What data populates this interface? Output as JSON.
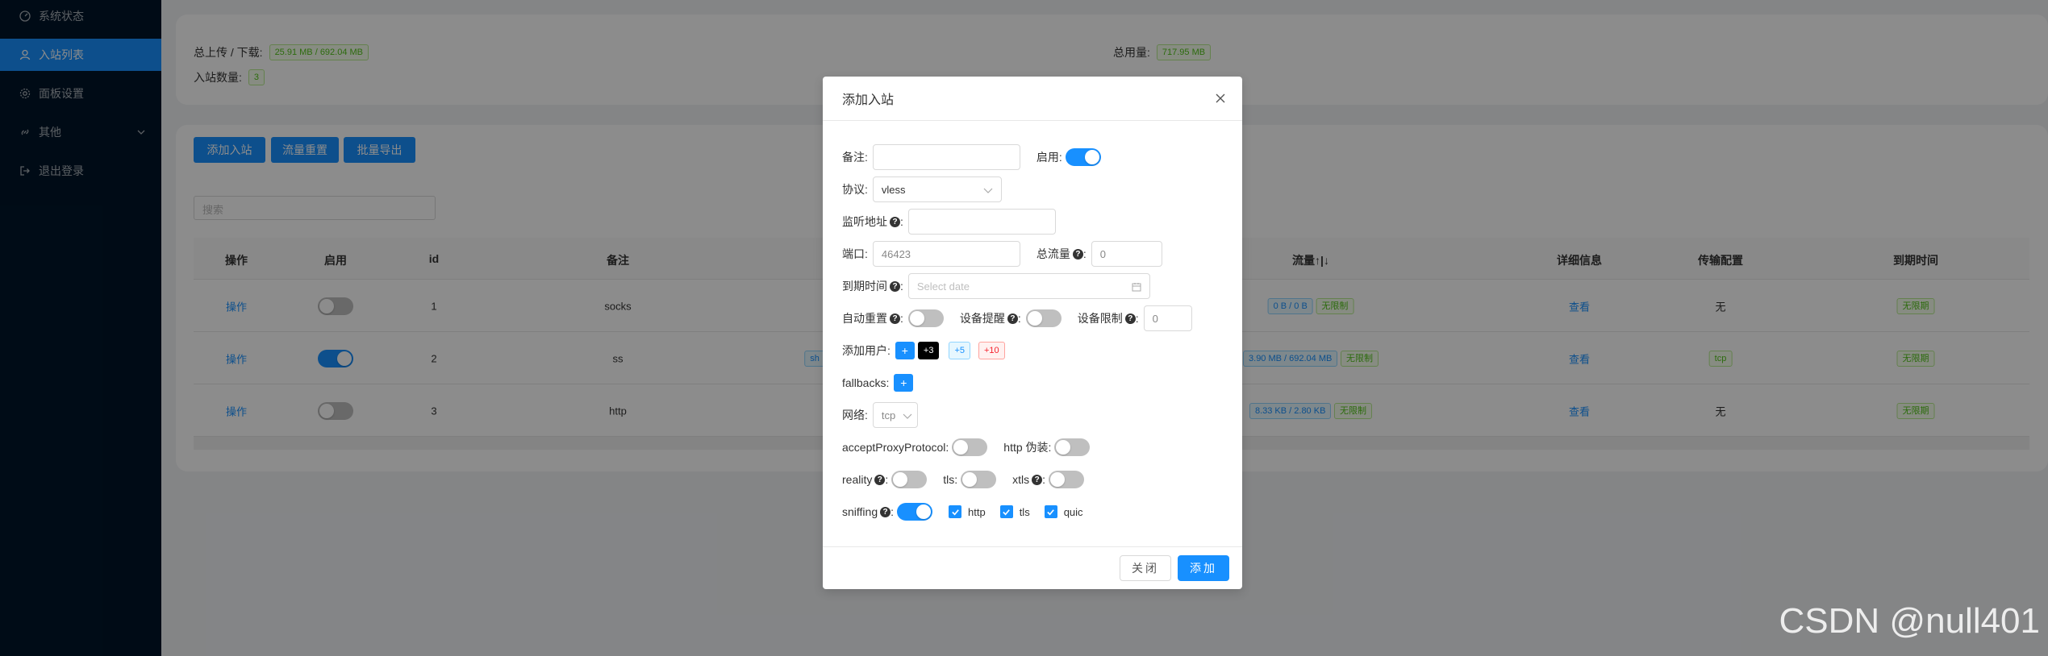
{
  "sidebar": {
    "items": [
      {
        "label": "系统状态",
        "icon": "dashboard-icon"
      },
      {
        "label": "入站列表",
        "icon": "user-icon",
        "active": true
      },
      {
        "label": "面板设置",
        "icon": "gear-icon"
      },
      {
        "label": "其他",
        "icon": "link-icon"
      },
      {
        "label": "退出登录",
        "icon": "logout-icon"
      }
    ]
  },
  "stats": {
    "upload_download_label": "总上传 / 下载:",
    "upload_download_value": "25.91 MB / 692.04 MB",
    "total_usage_label": "总用量:",
    "total_usage_value": "717.95 MB",
    "inbound_count_label": "入站数量:",
    "inbound_count_value": "3"
  },
  "toolbar": {
    "add_inbound": "添加入站",
    "reset_traffic": "流量重置",
    "batch_export": "批量导出",
    "search_placeholder": "搜索"
  },
  "table": {
    "headers": [
      "操作",
      "启用",
      "id",
      "备注",
      "流量↑|↓",
      "详细信息",
      "传输配置",
      "到期时间"
    ],
    "rows": [
      {
        "op": "操作",
        "enabled": false,
        "id": "1",
        "remark": "socks",
        "traffic": "0 B / 0 B",
        "limit": "无限制",
        "detail": "查看",
        "transport": "无",
        "expiry": "无限期"
      },
      {
        "op": "操作",
        "enabled": true,
        "id": "2",
        "remark": "ss",
        "protocol_tag": "sh",
        "traffic": "3.90 MB / 692.04 MB",
        "limit": "无限制",
        "detail": "查看",
        "transport": "tcp",
        "expiry": "无限期"
      },
      {
        "op": "操作",
        "enabled": false,
        "id": "3",
        "remark": "http",
        "traffic": "8.33 KB / 2.80 KB",
        "limit": "无限制",
        "detail": "查看",
        "transport": "无",
        "expiry": "无限期"
      }
    ]
  },
  "modal": {
    "title": "添加入站",
    "remark_label": "备注:",
    "remark_value": "",
    "enable_label": "启用:",
    "enable_on": true,
    "protocol_label": "协议:",
    "protocol_value": "vless",
    "listen_label": "监听地址",
    "listen_value": "",
    "port_label": "端口:",
    "port_value": "46423",
    "total_traffic_label": "总流量",
    "total_traffic_value": "0",
    "expiry_label": "到期时间",
    "expiry_placeholder": "Select date",
    "auto_reset_label": "自动重置",
    "device_alert_label": "设备提醒",
    "device_limit_label": "设备限制",
    "device_limit_value": "0",
    "add_user_label": "添加用户:",
    "add_user_plus": "+",
    "add_user_3": "+3",
    "add_user_5": "+5",
    "add_user_10": "+10",
    "fallbacks_label": "fallbacks:",
    "fallbacks_plus": "+",
    "network_label": "网络:",
    "network_value": "tcp",
    "accept_proxy_label": "acceptProxyProtocol:",
    "http_camouflage_label": "http 伪装:",
    "reality_label": "reality",
    "tls_label": "tls:",
    "xtls_label": "xtls",
    "sniffing_label": "sniffing",
    "sniff_http": "http",
    "sniff_tls": "tls",
    "sniff_quic": "quic",
    "cancel": "关闭",
    "confirm": "添加"
  },
  "watermark": "CSDN @null401",
  "colors": {
    "primary": "#1890ff",
    "sidebar": "#001529",
    "success": "#52c41a"
  }
}
